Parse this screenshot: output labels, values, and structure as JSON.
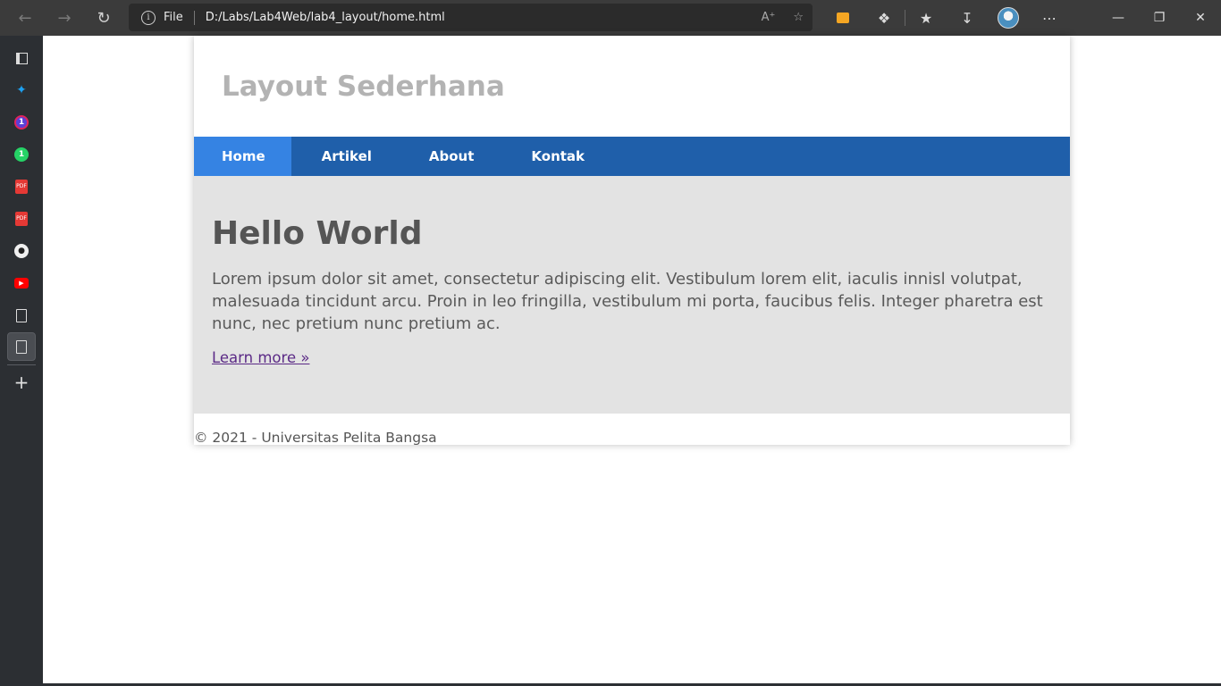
{
  "browser": {
    "address_prefix": "File",
    "url": "D:/Labs/Lab4Web/lab4_layout/home.html",
    "icons": {
      "back": "arrow-left-icon",
      "forward": "arrow-right-icon",
      "refresh": "refresh-icon",
      "info": "info-icon",
      "read_aloud": "read-aloud-icon",
      "add_favorite": "star-plus-icon",
      "extension_ext": "extension-icon",
      "extensions": "puzzle-icon",
      "favorites": "favorites-icon",
      "downloads": "download-icon",
      "profile": "avatar",
      "more": "more-icon",
      "minimize": "minimize-icon",
      "restore": "restore-icon",
      "close": "close-icon"
    }
  },
  "sidebar": {
    "items": [
      {
        "name": "tab-actions-icon"
      },
      {
        "name": "twitter-icon",
        "color": "#1da1f2"
      },
      {
        "name": "notification-icon",
        "color": "#e0245e"
      },
      {
        "name": "whatsapp-icon",
        "color": "#25d366"
      },
      {
        "name": "pdf-icon",
        "color": "#e53935"
      },
      {
        "name": "pdf-icon",
        "color": "#e53935"
      },
      {
        "name": "github-icon"
      },
      {
        "name": "youtube-icon",
        "color": "#ff0000"
      },
      {
        "name": "document-icon"
      },
      {
        "name": "document-icon"
      },
      {
        "name": "add-icon"
      }
    ]
  },
  "site": {
    "title": "Layout Sederhana",
    "nav": [
      "Home",
      "Artikel",
      "About",
      "Kontak"
    ],
    "hero": {
      "heading": "Hello World",
      "text": "Lorem ipsum dolor sit amet, consectetur adipiscing elit. Vestibulum lorem elit, iaculis innisl volutpat, malesuada tincidunt arcu. Proin in leo fringilla, vestibulum mi porta, faucibus felis. Integer pharetra est nunc, nec pretium nunc pretium ac.",
      "link": "Learn more »"
    },
    "footer": "© 2021 - Universitas Pelita Bangsa"
  },
  "colors": {
    "navbar": "#1f5faa",
    "nav_active": "#3583e3",
    "hero_bg": "#e3e3e3",
    "link": "#5b2a86"
  }
}
